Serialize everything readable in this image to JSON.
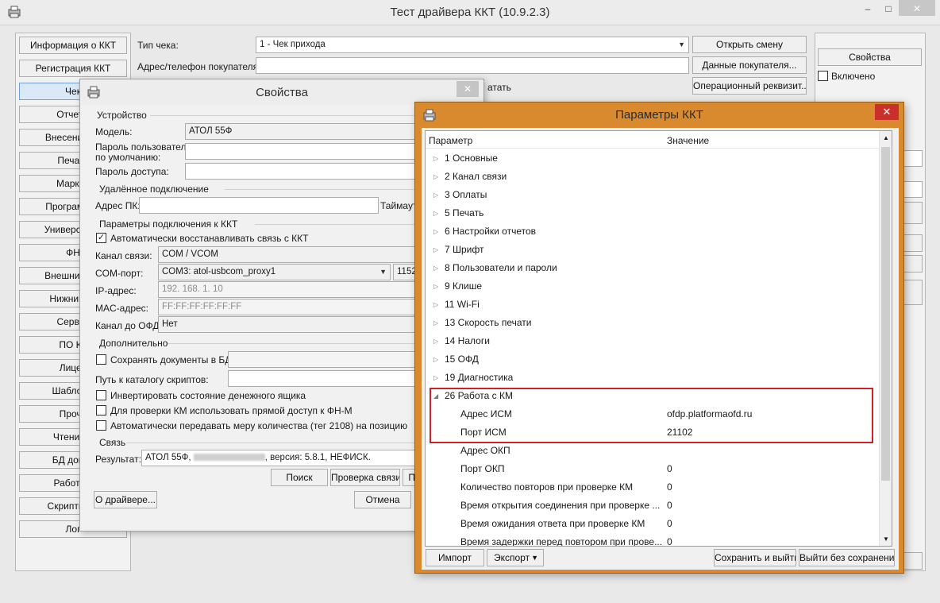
{
  "main": {
    "title": "Тест драйвера ККТ (10.9.2.3)",
    "window_controls": [
      "–",
      "□",
      "✕"
    ],
    "left_nav": [
      "Информация о ККТ",
      "Регистрация ККТ",
      "Чек",
      "Отчеты",
      "Внесения / в",
      "Печать",
      "Маркир",
      "Программир",
      "Универсальн",
      "ФН",
      "Внешние уст",
      "Нижний ур",
      "Сервис",
      "ПО КК",
      "Лицен",
      "Шаблоны",
      "Прочи",
      "Чтение д",
      "БД докум",
      "Работа с",
      "Скрипты др",
      "Лог"
    ],
    "receipt_type_label": "Тип чека:",
    "receipt_type_value": "1 - Чек прихода",
    "buyer_address_label": "Адрес/телефон покупателя:",
    "buyer_address_value": "",
    "open_shift": "Открыть смену",
    "buyer_data": "Данные покупателя...",
    "operational_requisite": "Операционный реквизит...",
    "partial_label": "атать",
    "properties_button": "Свойства",
    "enabled_label": "Включено"
  },
  "props": {
    "title": "Свойства",
    "close": "✕",
    "device_group": "Устройство",
    "model_label": "Модель:",
    "model_value": "АТОЛ 55Ф",
    "user_pass_label_1": "Пароль пользователя",
    "user_pass_label_2": "по умолчанию:",
    "access_pass_label": "Пароль доступа:",
    "remote_group": "Удалённое подключение",
    "pc_addr_label": "Адрес ПК:",
    "timeout_label": "Таймаут",
    "conn_group": "Параметры подключения к ККТ",
    "auto_restore_label": "Автоматически восстанавливать связь с ККТ",
    "channel_label": "Канал связи:",
    "channel_value": "COM / VCOM",
    "com_port_label": "COM-порт:",
    "com_port_value": "COM3: atol-usbcom_proxy1",
    "baud_value": "1152",
    "ip_label": "IP-адрес:",
    "ip_value": "192. 168. 1. 10",
    "mac_label": "MAC-адрес:",
    "mac_value": "FF:FF:FF:FF:FF:FF",
    "ofd_channel_label": "Канал до ОФД:",
    "ofd_channel_value": "Нет",
    "extra_group": "Дополнительно",
    "save_docs_label": "Сохранять документы в БД",
    "scripts_path_label": "Путь к каталогу скриптов:",
    "invert_label": "Инвертировать состояние денежного ящика",
    "direct_access_label": "Для проверки КМ использовать прямой доступ к ФН-М",
    "auto_measure_label": "Автоматически передавать меру количества (тег 2108) на позицию",
    "link_group": "Связь",
    "result_label": "Результат:",
    "result_prefix": "АТОЛ 55Ф,",
    "result_suffix": ", версия: 5.8.1, НЕФИСК.",
    "search_button": "Поиск",
    "check_link_button": "Проверка связи",
    "pa_button": "Па",
    "about_button": "О драйвере...",
    "cancel_button": "Отмена"
  },
  "kkt": {
    "title": "Параметры ККТ",
    "close": "✕",
    "col_param": "Параметр",
    "col_value": "Значение",
    "groups": [
      "1 Основные",
      "2 Канал связи",
      "3 Оплаты",
      "5 Печать",
      "6 Настройки отчетов",
      "7 Шрифт",
      "8 Пользователи и пароли",
      "9 Клише",
      "11 Wi-Fi",
      "13 Скорость печати",
      "14 Налоги",
      "15 ОФД",
      "19 Диагностика"
    ],
    "expanded_group": "26 Работа с КМ",
    "children": [
      {
        "name": "Адрес ИСМ",
        "value": "ofdp.platformaofd.ru"
      },
      {
        "name": "Порт ИСМ",
        "value": "21102"
      },
      {
        "name": "Адрес ОКП",
        "value": ""
      },
      {
        "name": "Порт ОКП",
        "value": "0"
      },
      {
        "name": "Количество повторов при проверке КМ",
        "value": "0"
      },
      {
        "name": "Время открытия соединения при проверке ...",
        "value": "0"
      },
      {
        "name": "Время ожидания ответа при проверке КМ",
        "value": "0"
      },
      {
        "name": "Время задержки перед повтором при прове...",
        "value": "0"
      }
    ],
    "import_button": "Импорт",
    "export_button": "Экспорт",
    "save_exit_button": "Сохранить и выйти",
    "exit_nosave_button": "Выйти без сохранения"
  }
}
